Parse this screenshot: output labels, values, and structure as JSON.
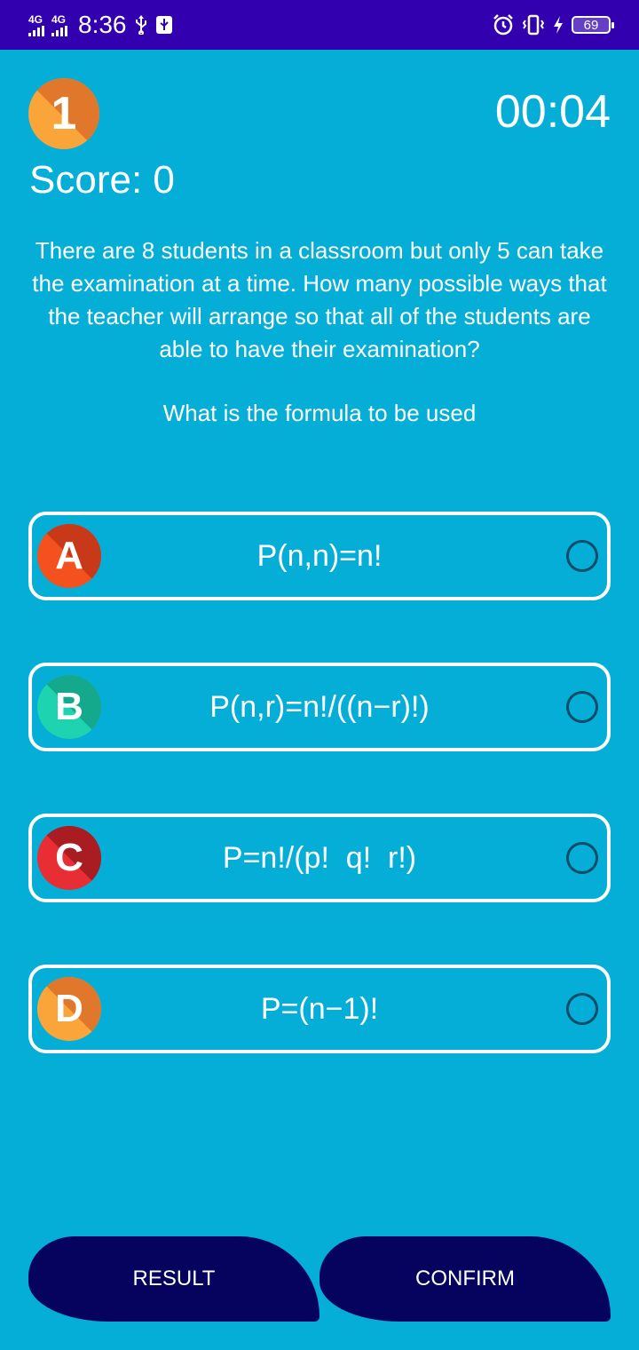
{
  "status_bar": {
    "network_1": "4G",
    "network_2": "4G",
    "time": "8:36",
    "battery": "69",
    "icons": [
      "usb-icon",
      "usb-debug-icon",
      "alarm-icon",
      "vibrate-icon",
      "charging-icon"
    ]
  },
  "quiz": {
    "question_number": "1",
    "timer": "00:04",
    "score": "Score: 0",
    "question": "There are 8 students in a classroom but only 5 can take the examination at a time. How many possible ways that the teacher will arrange so that all of the students are able to have their examination?",
    "subquestion": "What is the formula to be used"
  },
  "options": [
    {
      "letter": "A",
      "text": "P(n,n)=n!",
      "color": "#F4511E",
      "shadow": "#C8391A"
    },
    {
      "letter": "B",
      "text": "P(n,r)=n!/((n−r)!)",
      "color": "#1DD3B0",
      "shadow": "#14A88C"
    },
    {
      "letter": "C",
      "text": "P=n!/(p!  q!  r!)",
      "color": "#E82D34",
      "shadow": "#A81C22"
    },
    {
      "letter": "D",
      "text": "P=(n−1)!",
      "color": "#F9A53A",
      "shadow": "#E0772A"
    }
  ],
  "buttons": {
    "result": "RESULT",
    "confirm": "CONFIRM"
  },
  "colors": {
    "background": "#04AED6",
    "status_bar": "#3300B0",
    "button": "#05035E"
  }
}
